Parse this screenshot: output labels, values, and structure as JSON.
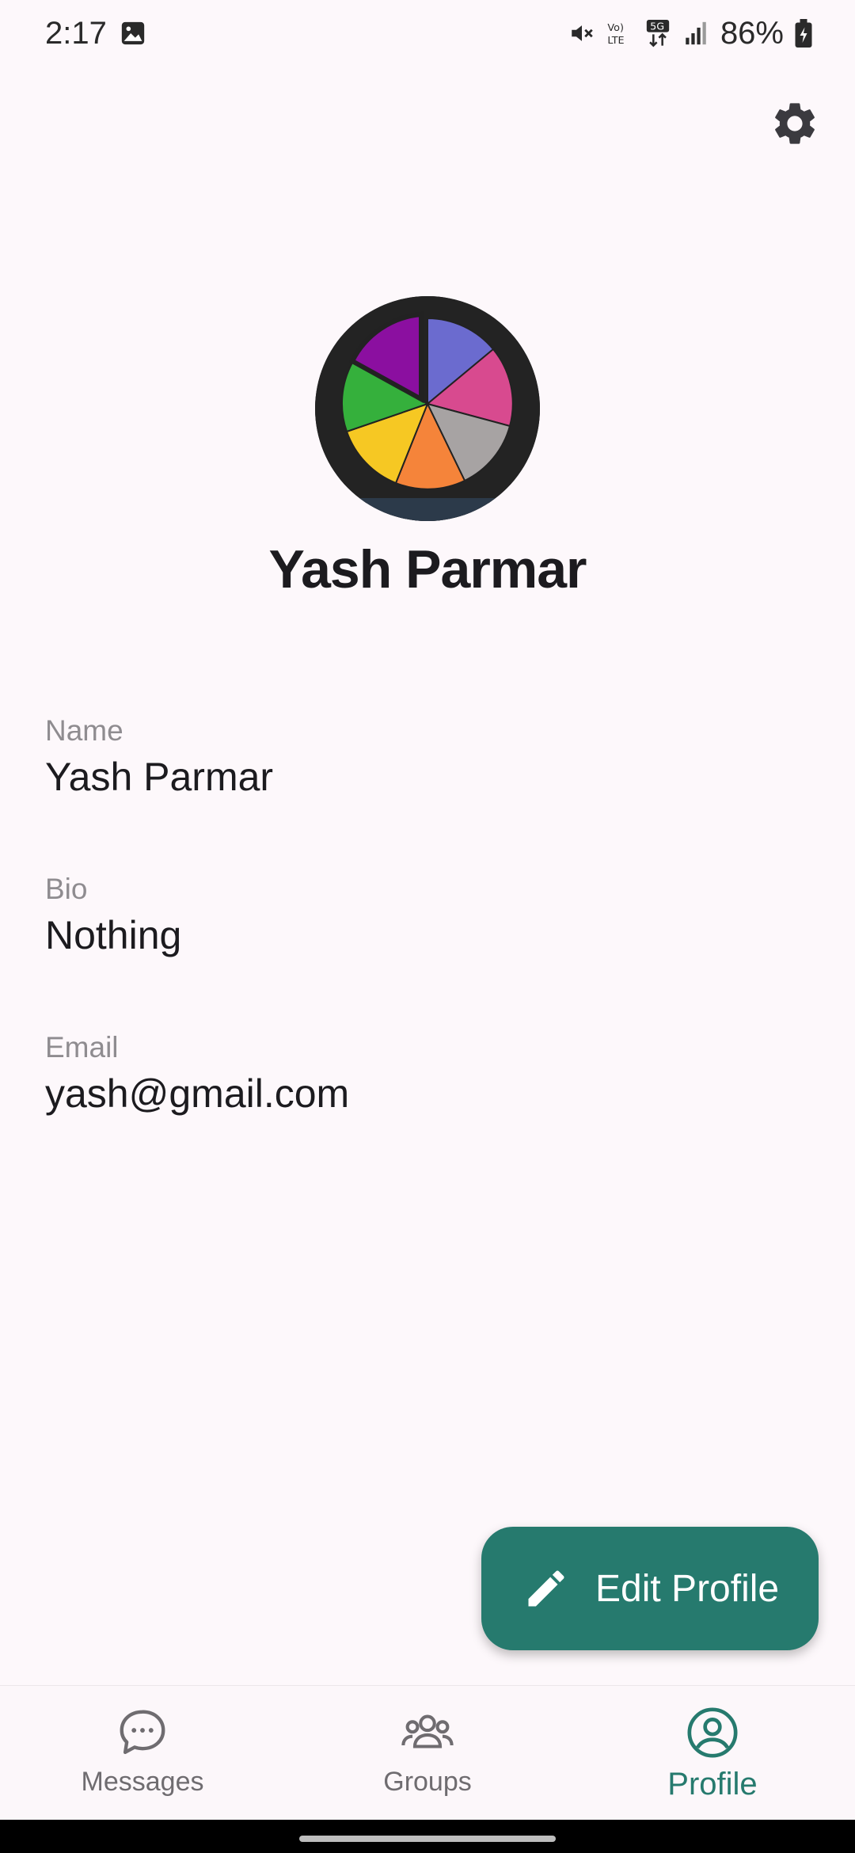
{
  "status_bar": {
    "time": "2:17",
    "battery": "86%",
    "icons": [
      "image-icon",
      "mute-icon",
      "volte-icon",
      "5g-icon",
      "signal-icon",
      "battery-icon"
    ]
  },
  "profile": {
    "display_name": "Yash Parmar"
  },
  "fields": [
    {
      "label": "Name",
      "value": "Yash Parmar"
    },
    {
      "label": "Bio",
      "value": "Nothing"
    },
    {
      "label": "Email",
      "value": "yash@gmail.com"
    }
  ],
  "fab": {
    "label": "Edit Profile",
    "icon": "pencil-icon"
  },
  "bottom_nav": {
    "items": [
      {
        "label": "Messages",
        "icon": "chat-bubble-icon",
        "active": false
      },
      {
        "label": "Groups",
        "icon": "groups-icon",
        "active": false
      },
      {
        "label": "Profile",
        "icon": "profile-icon",
        "active": true
      }
    ]
  },
  "colors": {
    "accent": "#267a6e",
    "background": "#fdf8fb",
    "text_primary": "#1c1b1f",
    "text_secondary": "#8f8c90"
  }
}
